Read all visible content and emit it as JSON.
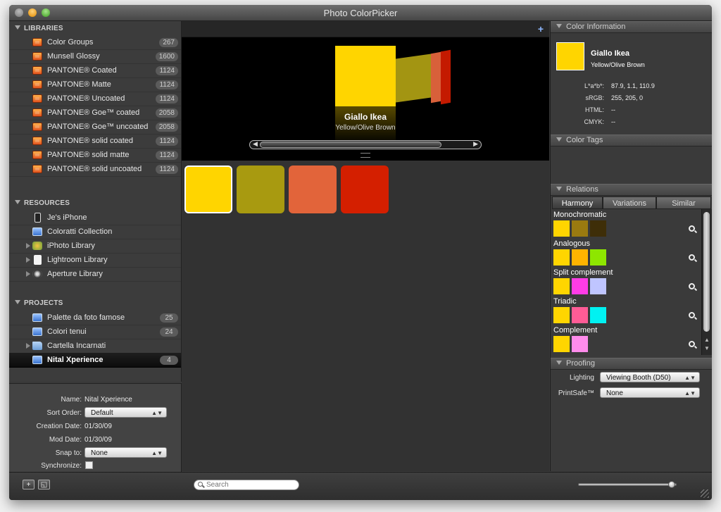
{
  "window": {
    "title": "Photo ColorPicker"
  },
  "sidebar": {
    "libraries": {
      "header": "LIBRARIES",
      "items": [
        {
          "label": "Color Groups",
          "count": "267"
        },
        {
          "label": "Munsell Glossy",
          "count": "1600"
        },
        {
          "label": "PANTONE® Coated",
          "count": "1124"
        },
        {
          "label": "PANTONE® Matte",
          "count": "1124"
        },
        {
          "label": "PANTONE® Uncoated",
          "count": "1124"
        },
        {
          "label": "PANTONE® Goe™ coated",
          "count": "2058"
        },
        {
          "label": "PANTONE® Goe™ uncoated",
          "count": "2058"
        },
        {
          "label": "PANTONE® solid coated",
          "count": "1124"
        },
        {
          "label": "PANTONE® solid matte",
          "count": "1124"
        },
        {
          "label": "PANTONE® solid uncoated",
          "count": "1124"
        }
      ]
    },
    "resources": {
      "header": "RESOURCES",
      "items": [
        {
          "label": "Je's iPhone",
          "icon": "iphone-icon"
        },
        {
          "label": "Coloratti Collection",
          "icon": "collection-icon"
        },
        {
          "label": "iPhoto Library",
          "icon": "iphoto-icon"
        },
        {
          "label": "Lightroom Library",
          "icon": "document-icon"
        },
        {
          "label": "Aperture Library",
          "icon": "aperture-icon"
        }
      ]
    },
    "projects": {
      "header": "PROJECTS",
      "items": [
        {
          "label": "Palette da foto famose",
          "count": "25"
        },
        {
          "label": "Colori tenui",
          "count": "24"
        },
        {
          "label": "Cartella Incarnati",
          "count": ""
        },
        {
          "label": "Nital Xperience",
          "count": "4",
          "selected": true
        }
      ]
    }
  },
  "project_info": {
    "name_label": "Name:",
    "name_value": "Nital Xperience",
    "sort_label": "Sort Order:",
    "sort_value": "Default",
    "creation_label": "Creation Date:",
    "creation_value": "01/30/09",
    "mod_label": "Mod Date:",
    "mod_value": "01/30/09",
    "snap_label": "Snap to:",
    "snap_value": "None",
    "sync_label": "Synchronize:"
  },
  "preview": {
    "name": "Giallo Ikea",
    "subtitle": "Yellow/Olive Brown",
    "swatches": [
      "#FFD500",
      "#A89A10",
      "#E2643A",
      "#D41F00"
    ]
  },
  "color_info": {
    "header": "Color Information",
    "name": "Giallo Ikea",
    "subtitle": "Yellow/Olive Brown",
    "color": "#FFD500",
    "lab_label": "L*a*b*:",
    "lab_value": "87.9, 1.1, 110.9",
    "srgb_label": "sRGB:",
    "srgb_value": "255, 205, 0",
    "html_label": "HTML:",
    "html_value": "--",
    "cmyk_label": "CMYK:",
    "cmyk_value": "--"
  },
  "color_tags": {
    "header": "Color Tags"
  },
  "relations": {
    "header": "Relations",
    "tabs": [
      "Harmony",
      "Variations",
      "Similar"
    ],
    "groups": [
      {
        "label": "Monochromatic",
        "colors": [
          "#FFD500",
          "#9A7A10",
          "#3E2E08"
        ]
      },
      {
        "label": "Analogous",
        "colors": [
          "#FFD500",
          "#FFB400",
          "#8EE600"
        ]
      },
      {
        "label": "Split complement",
        "colors": [
          "#FFD500",
          "#FF3CE6",
          "#BFC5FF"
        ]
      },
      {
        "label": "Triadic",
        "colors": [
          "#FFD500",
          "#FF5C96",
          "#00F2F2"
        ]
      },
      {
        "label": "Complement",
        "colors": [
          "#FFD500",
          "#FF8CEC"
        ]
      }
    ]
  },
  "proofing": {
    "header": "Proofing",
    "lighting_label": "Lighting",
    "lighting_value": "Viewing Booth (D50)",
    "printsafe_label": "PrintSafe™",
    "printsafe_value": "None"
  },
  "bottom": {
    "search_placeholder": "Search"
  }
}
